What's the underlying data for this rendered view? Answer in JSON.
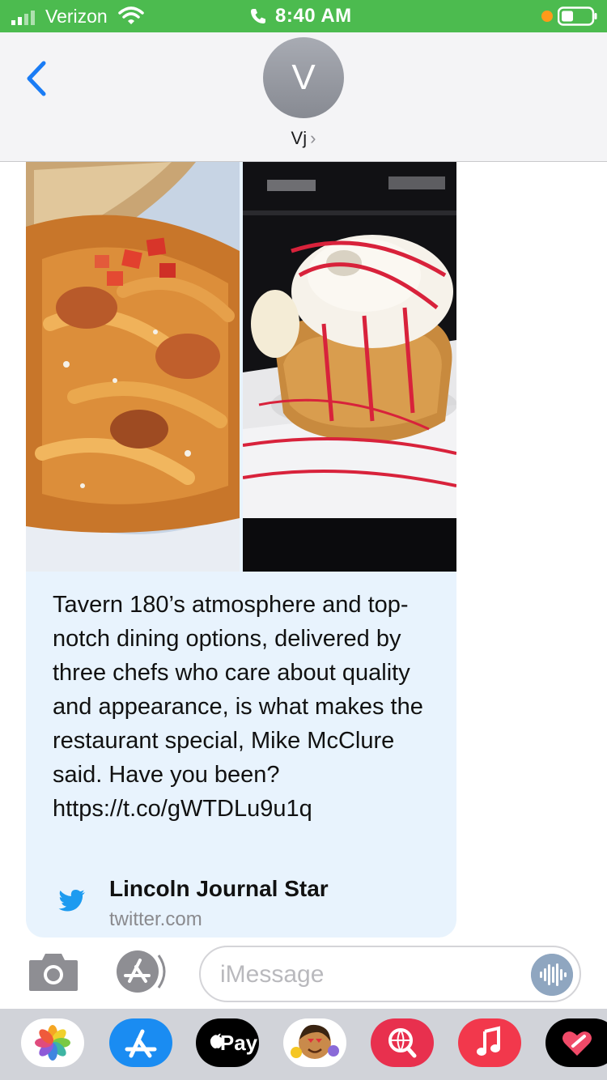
{
  "status_bar": {
    "carrier": "Verizon",
    "time": "8:40 AM",
    "background_color": "#4cbb4f",
    "icons": [
      "signal-icon",
      "wifi-icon",
      "phone-icon",
      "orange-dot",
      "battery-icon"
    ]
  },
  "header": {
    "avatar_initial": "V",
    "contact_name": "Vj",
    "chevron": "›",
    "back_icon": "chevron-left-icon"
  },
  "message": {
    "text": "Tavern 180’s atmosphere and top-notch dining options, delivered by three chefs who care about quality and appearance, is what makes the restaurant special, Mike McClure said. Have you been? https://t.co/gWTDLu9u1q",
    "bubble_color": "#e8f3fd",
    "images": [
      "pasta-with-shrimp-photo",
      "dessert-with-ice-cream-photo"
    ],
    "link_preview": {
      "title": "Lincoln Journal Star",
      "domain": "twitter.com",
      "icon": "twitter-bird-icon"
    }
  },
  "input_bar": {
    "placeholder": "iMessage",
    "icons": [
      "camera-icon",
      "app-store-icon",
      "audio-waveform-icon"
    ]
  },
  "app_drawer": {
    "background_color": "#d1d3d9",
    "apps": [
      {
        "name": "Photos",
        "icon": "photos-icon"
      },
      {
        "name": "App Store",
        "icon": "app-store-icon"
      },
      {
        "name": "Apple Pay",
        "icon": "apple-pay-icon",
        "label": "Pay"
      },
      {
        "name": "Memoji",
        "icon": "memoji-icon"
      },
      {
        "name": "Web Search",
        "icon": "globe-search-icon"
      },
      {
        "name": "Music",
        "icon": "music-note-icon"
      },
      {
        "name": "Digital Touch",
        "icon": "heart-touch-icon"
      }
    ]
  }
}
